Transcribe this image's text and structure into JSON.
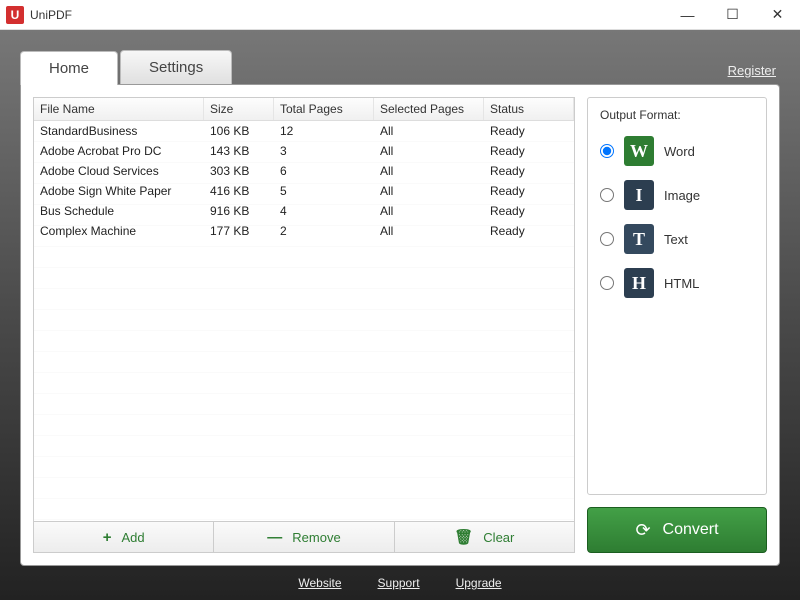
{
  "app": {
    "title": "UniPDF",
    "icon_letter": "U"
  },
  "tabs": {
    "home": "Home",
    "settings": "Settings"
  },
  "register_link": "Register",
  "columns": {
    "name": "File Name",
    "size": "Size",
    "pages": "Total Pages",
    "selected": "Selected Pages",
    "status": "Status"
  },
  "files": [
    {
      "name": "StandardBusiness",
      "size": "106 KB",
      "pages": "12",
      "selected": "All",
      "status": "Ready"
    },
    {
      "name": "Adobe Acrobat Pro DC",
      "size": "143 KB",
      "pages": "3",
      "selected": "All",
      "status": "Ready"
    },
    {
      "name": "Adobe Cloud Services",
      "size": "303 KB",
      "pages": "6",
      "selected": "All",
      "status": "Ready"
    },
    {
      "name": "Adobe Sign White Paper",
      "size": "416 KB",
      "pages": "5",
      "selected": "All",
      "status": "Ready"
    },
    {
      "name": "Bus Schedule",
      "size": "916 KB",
      "pages": "4",
      "selected": "All",
      "status": "Ready"
    },
    {
      "name": "Complex Machine",
      "size": "177 KB",
      "pages": "2",
      "selected": "All",
      "status": "Ready"
    }
  ],
  "actions": {
    "add": "Add",
    "remove": "Remove",
    "clear": "Clear"
  },
  "output": {
    "header": "Output Format:",
    "options": [
      {
        "label": "Word",
        "letter": "W",
        "cls": "ic-word",
        "checked": true
      },
      {
        "label": "Image",
        "letter": "I",
        "cls": "ic-image",
        "checked": false
      },
      {
        "label": "Text",
        "letter": "T",
        "cls": "ic-text",
        "checked": false
      },
      {
        "label": "HTML",
        "letter": "H",
        "cls": "ic-html",
        "checked": false
      }
    ]
  },
  "convert_label": "Convert",
  "footer": {
    "website": "Website",
    "support": "Support",
    "upgrade": "Upgrade"
  }
}
